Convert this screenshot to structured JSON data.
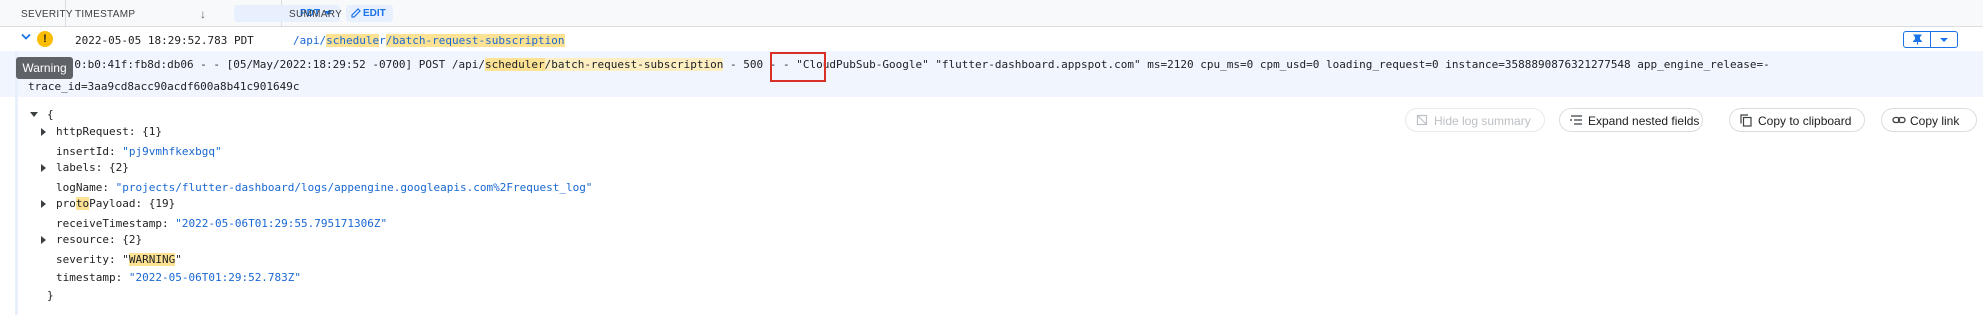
{
  "header": {
    "severity_label": "SEVERITY",
    "timestamp_label": "TIMESTAMP",
    "tz_label": "PDT",
    "summary_label": "SUMMARY",
    "edit_label": "EDIT"
  },
  "row": {
    "timestamp": "2022-05-05 18:29:52.783 PDT",
    "summary_prefix": "/api/",
    "summary_hl1": "schedule",
    "summary_mid": "r",
    "summary_hl2": "/batch-request-subscription",
    "tooltip": "Warning",
    "severity_icon": "!"
  },
  "raw": {
    "line1_a": "d:b712:0:b0:41f:fb8d:db06 - - [05/May/2022:18:29:52 -0700] POST /api/",
    "line1_hl1": "scheduler",
    "line1_hl2": "/batch-request-subscription",
    "line1_b": " - 500 - - \"CloudPubSub-Google\" \"flutter-dashboard.appspot.com\" ms=2120 cpu_ms=0 cpm_usd=0 loading_request=0 instance=3588890876321277548 app_engine_release=-",
    "line2": "trace_id=3aa9cd8acc90acdf600a8b41c901649c"
  },
  "actions": {
    "hide": "Hide log summary",
    "expand": "Expand nested fields",
    "copy": "Copy to clipboard",
    "link": "Copy link"
  },
  "tree": {
    "open": "{",
    "close": "}",
    "httpRequest_key": "httpRequest:",
    "httpRequest_val": "{1}",
    "insertId_key": "insertId:",
    "insertId_val": "\"pj9vmhfkexbgq\"",
    "labels_key": "labels:",
    "labels_val": "{2}",
    "logName_key": "logName:",
    "logName_val": "\"projects/flutter-dashboard/logs/appengine.googleapis.com%2Frequest_log\"",
    "proto_a": "pro",
    "proto_hl": "to",
    "proto_b": "Payload:",
    "protoPayload_val": "{19}",
    "receive_key": "receiveTimestamp:",
    "receive_val": "\"2022-05-06T01:29:55.795171306Z\"",
    "resource_key": "resource:",
    "resource_val": "{2}",
    "severity_key": "severity:",
    "severity_q1": "\"",
    "severity_hl": "WARNING",
    "severity_q2": "\"",
    "timestamp_key": "timestamp:",
    "timestamp_val": "\"2022-05-06T01:29:52.783Z\""
  },
  "colors": {
    "accent": "#1a73e8",
    "highlight": "#fde293",
    "warning": "#fbbc04",
    "error_box": "#d93025"
  }
}
